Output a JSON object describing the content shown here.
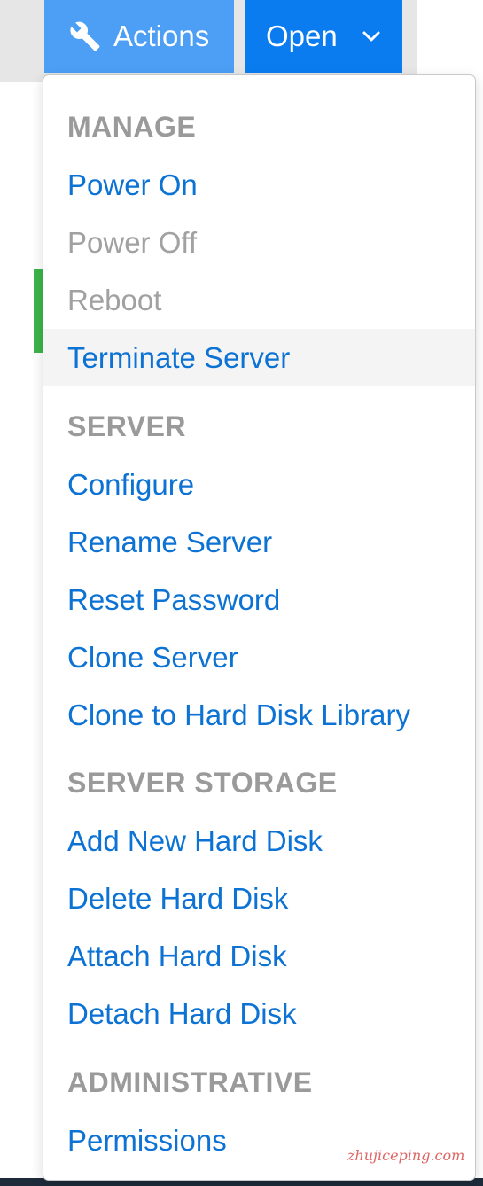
{
  "toolbar": {
    "actions_label": "Actions",
    "actions_icon": "wrench-icon",
    "open_label": "Open",
    "open_icon": "chevron-down-icon"
  },
  "menu": {
    "sections": [
      {
        "header": "MANAGE",
        "items": [
          {
            "label": "Power On",
            "state": "enabled"
          },
          {
            "label": "Power Off",
            "state": "disabled"
          },
          {
            "label": "Reboot",
            "state": "disabled"
          },
          {
            "label": "Terminate Server",
            "state": "hovered"
          }
        ]
      },
      {
        "header": "SERVER",
        "items": [
          {
            "label": "Configure",
            "state": "enabled"
          },
          {
            "label": "Rename Server",
            "state": "enabled"
          },
          {
            "label": "Reset Password",
            "state": "enabled"
          },
          {
            "label": "Clone Server",
            "state": "enabled"
          },
          {
            "label": "Clone to Hard Disk Library",
            "state": "enabled"
          }
        ]
      },
      {
        "header": "SERVER STORAGE",
        "items": [
          {
            "label": "Add New Hard Disk",
            "state": "enabled"
          },
          {
            "label": "Delete Hard Disk",
            "state": "enabled"
          },
          {
            "label": "Attach Hard Disk",
            "state": "enabled"
          },
          {
            "label": "Detach Hard Disk",
            "state": "enabled"
          }
        ]
      },
      {
        "header": "ADMINISTRATIVE",
        "items": [
          {
            "label": "Permissions",
            "state": "enabled"
          }
        ]
      }
    ]
  },
  "watermark": "zhujiceping.com",
  "colors": {
    "actions_button": "#4c9ff5",
    "open_button": "#0a7cf0",
    "link": "#0c72d4",
    "disabled": "#a1a1a1",
    "header": "#9a9a9a",
    "status_green": "#3cb44a"
  }
}
